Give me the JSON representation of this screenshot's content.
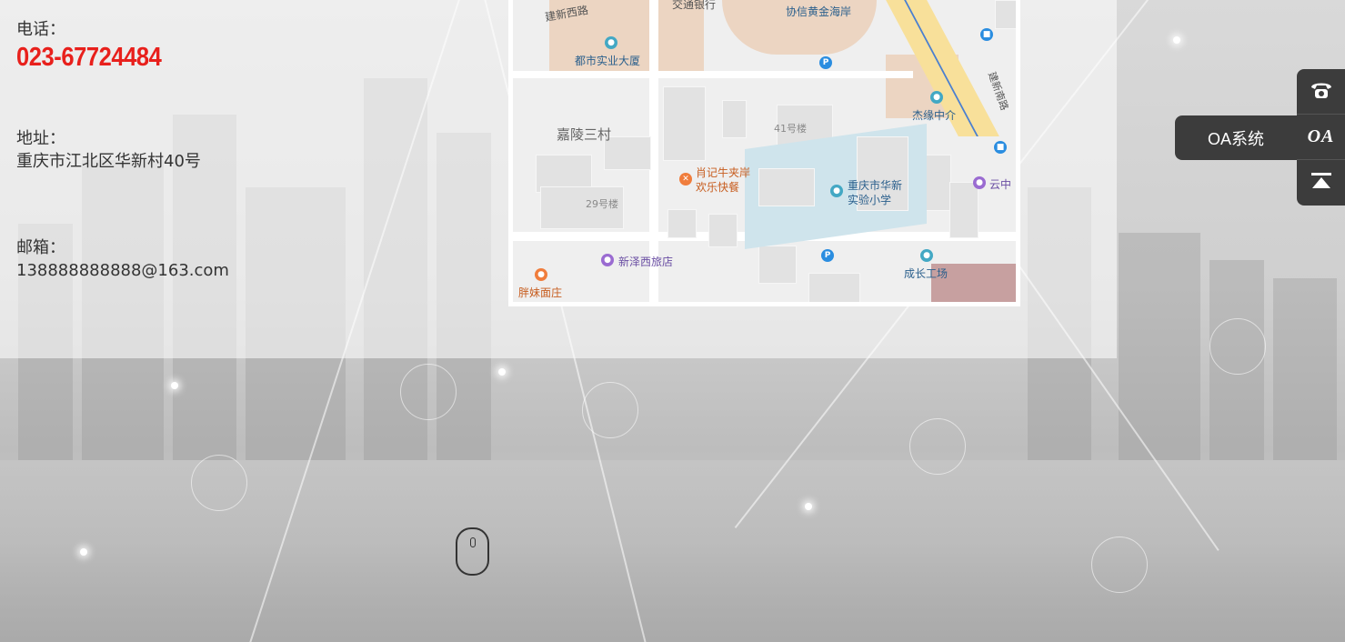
{
  "contact": {
    "phone_label": "电话：",
    "phone_value": "023-67724484",
    "address_label": "地址：",
    "address_value": "重庆市江北区华新村40号",
    "email_label": "邮箱：",
    "email_value": "138888888888@163.com"
  },
  "map": {
    "labels": {
      "jianxin_west_road": "建新西路",
      "bank": "交通银行",
      "xiexin": "协信黄金海岸",
      "dushi": "都市实业大厦",
      "jialing": "嘉陵三村",
      "b41": "41号楼",
      "jieyuan": "杰缘中介",
      "xiaoji_1": "肖记牛夹岸",
      "xiaoji_2": "欢乐快餐",
      "school_1": "重庆市华新",
      "school_2": "实验小学",
      "yunzhong": "云中",
      "b29": "29号楼",
      "xinze": "新泽西旅店",
      "chengzhang": "成长工场",
      "pangmei": "胖妹面庄",
      "jianxin_south_road": "建新南路"
    }
  },
  "side_toolbar": {
    "phone_icon": "phone-icon",
    "oa_icon_text": "OA",
    "top_icon": "back-to-top-icon",
    "oa_popup_label": "OA系统"
  },
  "scroll_hint": {
    "icon": "mouse-scroll-icon"
  }
}
